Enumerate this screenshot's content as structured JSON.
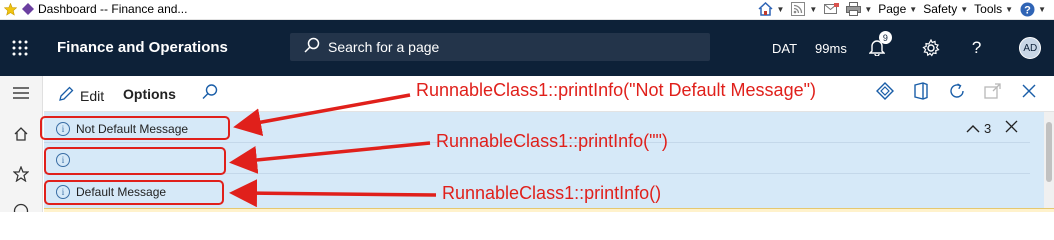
{
  "browser": {
    "tab_title": "Dashboard -- Finance and...",
    "tools": [
      "Page",
      "Safety",
      "Tools"
    ]
  },
  "navbar": {
    "app_title": "Finance and Operations",
    "search_placeholder": "Search for a page",
    "company": "DAT",
    "timing": "99ms",
    "notification_count": "9",
    "help_label": "?",
    "avatar_initials": "AD"
  },
  "actionpane": {
    "edit_label": "Edit",
    "options_label": "Options"
  },
  "messages": {
    "items": [
      {
        "text": "Not Default Message"
      },
      {
        "text": ""
      },
      {
        "text": "Default Message"
      }
    ],
    "count": "3"
  },
  "annotations": [
    {
      "text": "RunnableClass1::printInfo(\"Not Default Message\")"
    },
    {
      "text": "RunnableClass1::printInfo(\"\")"
    },
    {
      "text": "RunnableClass1::printInfo()"
    }
  ],
  "colors": {
    "navbar": "#0d2138",
    "message_bar": "#d6e9f8",
    "annotation_red": "#e0201b"
  }
}
